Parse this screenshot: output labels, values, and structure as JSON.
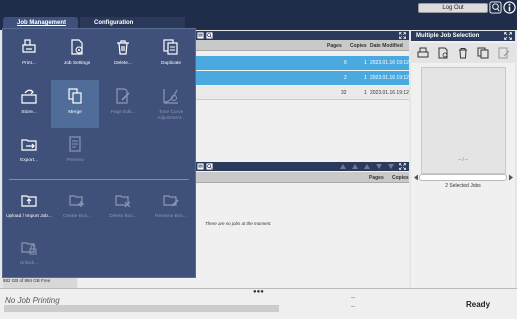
{
  "topbar": {
    "logout_label": "Log Out"
  },
  "tabs": {
    "job_management": "Job Management",
    "configuration": "Configuration"
  },
  "list": {
    "headers": {
      "pages": "Pages",
      "copies": "Copies",
      "date_modified": "Date Modified"
    },
    "rows": [
      {
        "pages": "6",
        "copies": "1",
        "date": "2023.01.16 19:12",
        "selected": true
      },
      {
        "pages": "2",
        "copies": "1",
        "date": "2023.01.16 19:12",
        "selected": true
      },
      {
        "pages": "32",
        "copies": "1",
        "date": "2023.01.16 19:12",
        "selected": false
      }
    ],
    "lower_headers": {
      "pages": "Pages",
      "copies": "Copies"
    },
    "empty_message": "There are no jobs at the moment."
  },
  "multiple": {
    "title": "Multiple Job Selection",
    "page_indicator": "-- / --",
    "selected_count": "2 Selected Jobs"
  },
  "popup": {
    "row1": [
      "Print...",
      "Job Settings",
      "Delete...",
      "Duplicate"
    ],
    "row2": [
      "Store...",
      "Merge",
      "Page Edit...",
      "Tone Curve Adjustment..."
    ],
    "row3": [
      "Export...",
      "Preview"
    ],
    "row4": [
      "Upload / Import Job...",
      "Create Box...",
      "Delete Box...",
      "Rename Box..."
    ],
    "row5": [
      "Unlock..."
    ]
  },
  "storage": "882 GB of 884 GB Free",
  "status": {
    "text": "No Job Printing",
    "ready": "Ready",
    "dashes": "--\n--"
  }
}
